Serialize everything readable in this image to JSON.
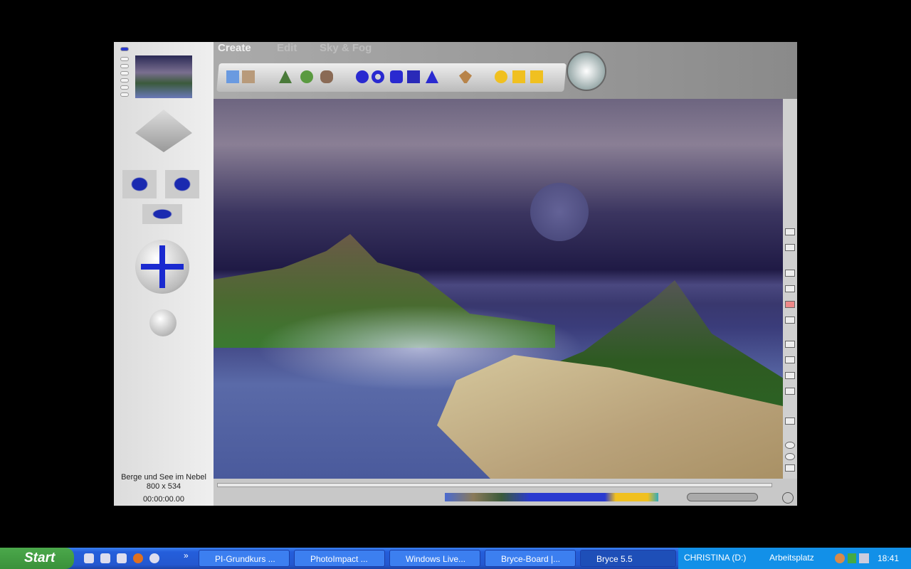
{
  "menu": {
    "create": "Create",
    "edit": "Edit",
    "sky_fog": "Sky & Fog"
  },
  "scene": {
    "name": "Berge und See im Nebel",
    "size": "800 x 534",
    "time": "00:00:00.00"
  },
  "taskbar": {
    "start": "Start",
    "tasks": [
      {
        "label": "PI-Grundkurs ..."
      },
      {
        "label": "PhotoImpact ..."
      },
      {
        "label": "Windows Live..."
      },
      {
        "label": "Bryce-Board |..."
      },
      {
        "label": "Bryce 5.5"
      }
    ],
    "drive": "CHRISTINA (D:)",
    "desktop": "Arbeitsplatz",
    "clock": "18:41",
    "chevron": "»"
  }
}
